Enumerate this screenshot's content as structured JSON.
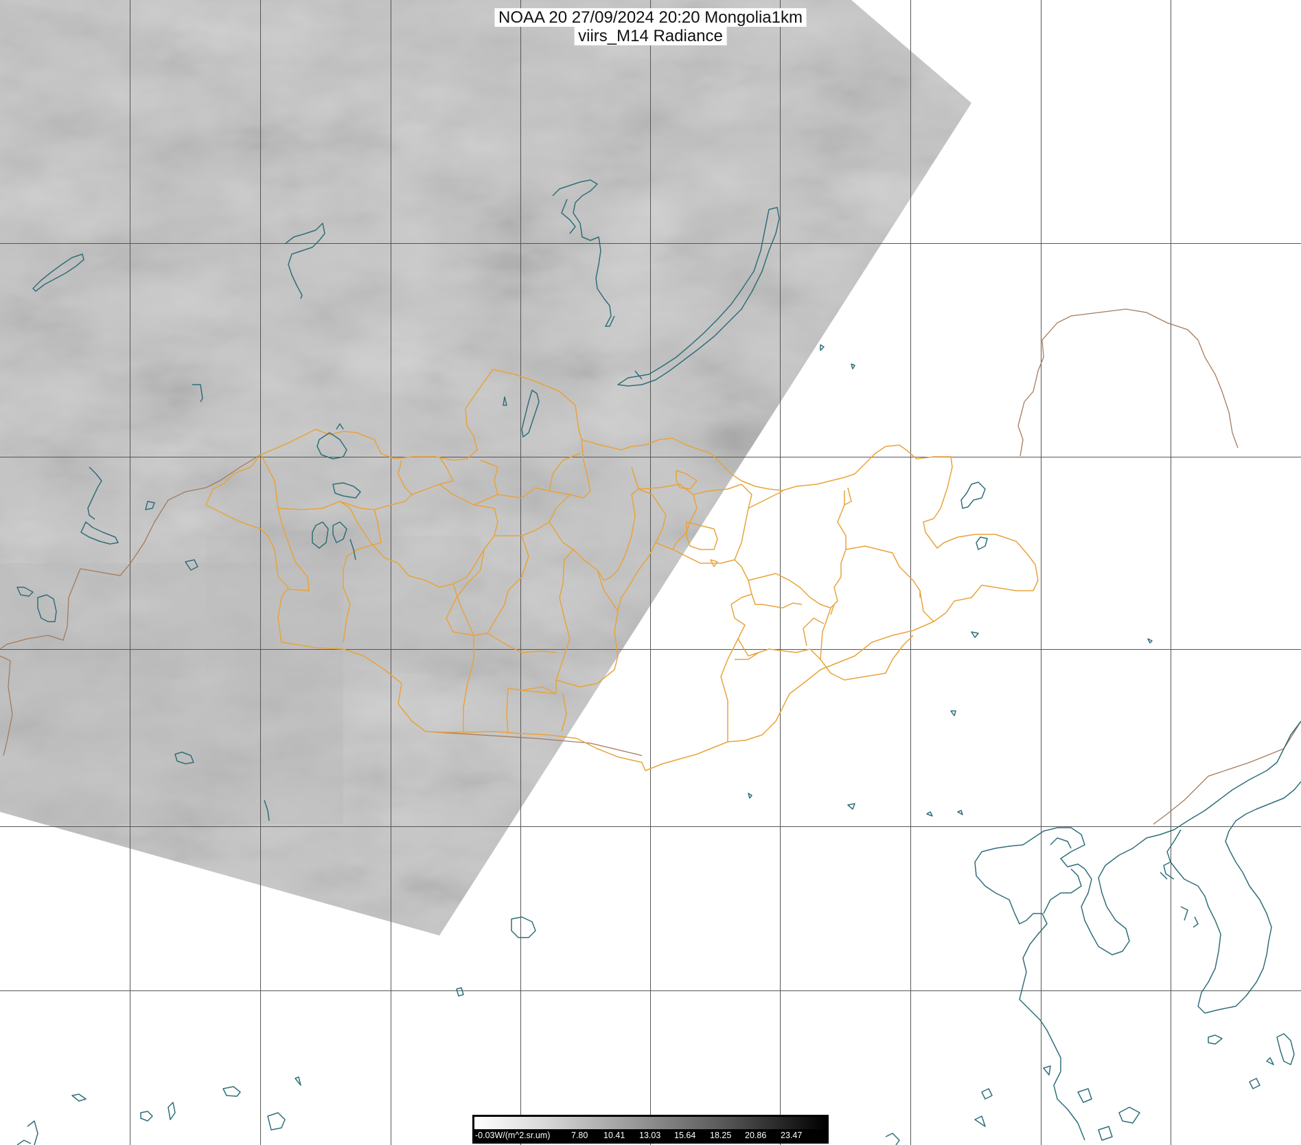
{
  "title": {
    "line1": "NOAA 20 27/09/2024 20:20 Mongolia1km",
    "line2": "viirs_M14 Radiance"
  },
  "colorbar": {
    "unit_label": "-0.03W/(m^2.sr.um)",
    "ticks": [
      "7.80",
      "10.41",
      "13.03",
      "15.64",
      "18.25",
      "20.86",
      "23.47"
    ]
  },
  "colors": {
    "grid": "#555555",
    "province_borders": "#e8a33a",
    "country_borders": "#a57a5a",
    "coast_lakes_rivers": "#2e6e78",
    "imagery_base": "#c9c9c9"
  }
}
